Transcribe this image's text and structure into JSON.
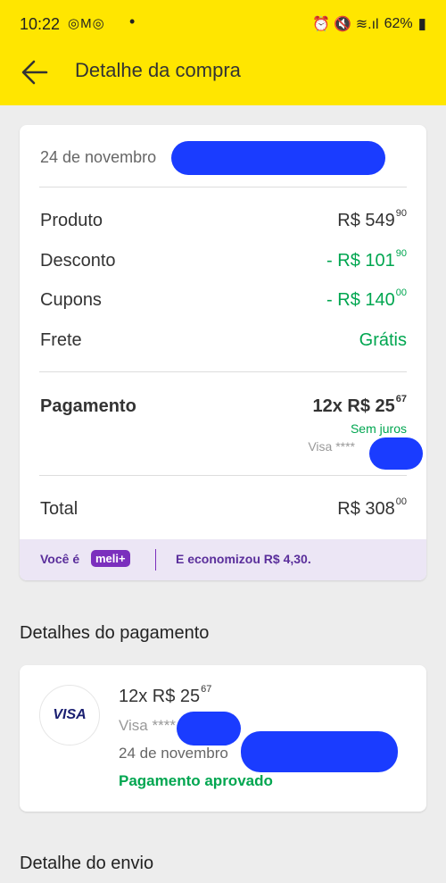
{
  "status_bar": {
    "time": "10:22",
    "notifications": "◎M◎",
    "dot": "•",
    "right_icons": "⏰ 🔇 ≋.ıl",
    "battery": "62%"
  },
  "header": {
    "title": "Detalhe da compra"
  },
  "summary": {
    "date": "24 de novembro",
    "rows": [
      {
        "label": "Produto",
        "value": "R$ 549",
        "cents": "90"
      },
      {
        "label": "Desconto",
        "value": "- R$ 101",
        "cents": "90"
      },
      {
        "label": "Cupons",
        "value": "- R$ 140",
        "cents": "00"
      },
      {
        "label": "Frete",
        "value": "Grátis",
        "cents": ""
      }
    ],
    "payment": {
      "label": "Pagamento",
      "value": "12x R$ 25",
      "cents": "67",
      "note": "Sem juros",
      "card": "Visa ****"
    },
    "total": {
      "label": "Total",
      "value": "R$ 308",
      "cents": "00"
    },
    "meli": {
      "voce": "Você é",
      "badge": "meli+",
      "economy": "E economizou R$ 4,30."
    }
  },
  "payment_details": {
    "section_title": "Detalhes do pagamento",
    "brand": "VISA",
    "installments": "12x R$ 25",
    "cents": "67",
    "card": "Visa ****",
    "date": "24 de novembro",
    "status": "Pagamento aprovado"
  },
  "shipping": {
    "section_title": "Detalhe do envio"
  },
  "colors": {
    "header_bg": "#ffe600",
    "green": "#00a650",
    "redaction": "#1a3cff",
    "meli_purple": "#7b2fbd"
  }
}
